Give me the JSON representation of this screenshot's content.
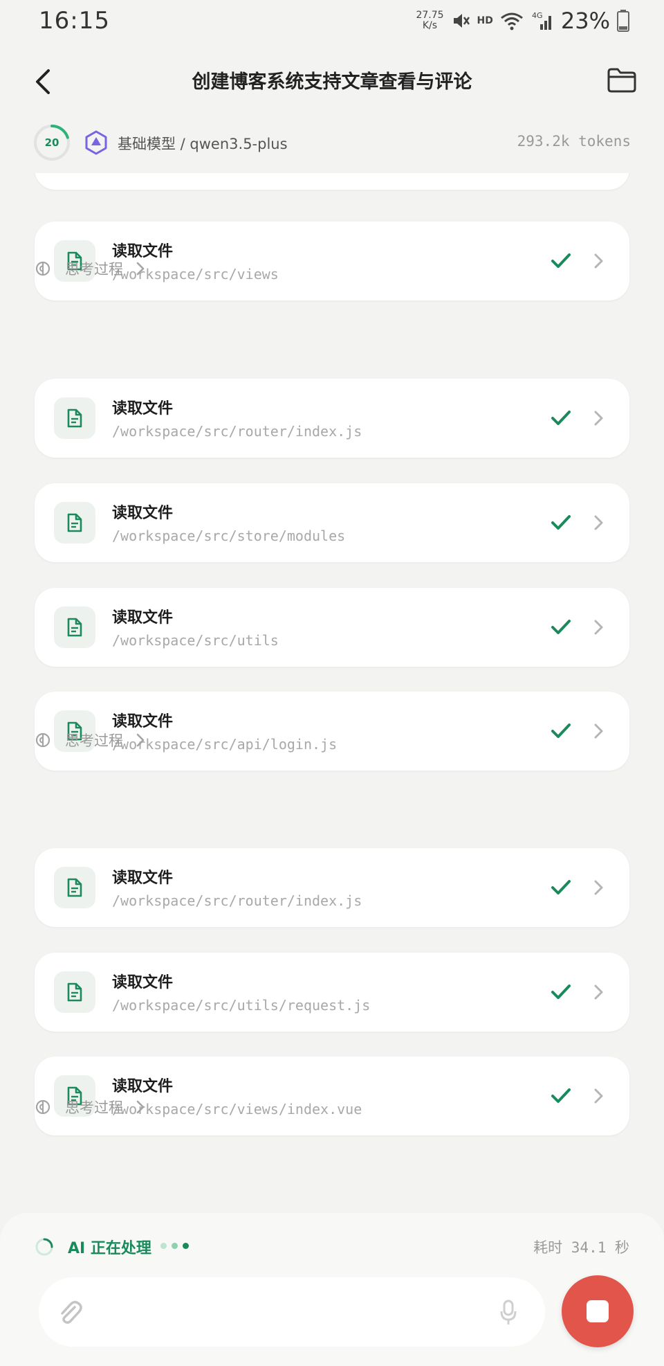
{
  "status_bar": {
    "time": "16:15",
    "speed_value": "27.75",
    "speed_unit": "K/s",
    "hd": "HD",
    "network": "4G",
    "battery": "23%"
  },
  "header": {
    "title": "创建博客系统支持文章查看与评论",
    "back_icon": "back-arrow-icon",
    "folder_icon": "folder-icon"
  },
  "model_bar": {
    "progress": "20",
    "model": "基础模型 / qwen3.5-plus",
    "tokens": "293.2k tokens"
  },
  "items": [
    {
      "type": "file",
      "title": "读取文件",
      "path": "/workspace/src/views",
      "status": "done"
    },
    {
      "type": "think",
      "label": "思考过程"
    },
    {
      "type": "file",
      "title": "读取文件",
      "path": "/workspace/src/router/index.js",
      "status": "done"
    },
    {
      "type": "file",
      "title": "读取文件",
      "path": "/workspace/src/store/modules",
      "status": "done"
    },
    {
      "type": "file",
      "title": "读取文件",
      "path": "/workspace/src/utils",
      "status": "done"
    },
    {
      "type": "file",
      "title": "读取文件",
      "path": "/workspace/src/api/login.js",
      "status": "done"
    },
    {
      "type": "think",
      "label": "思考过程"
    },
    {
      "type": "file",
      "title": "读取文件",
      "path": "/workspace/src/router/index.js",
      "status": "done"
    },
    {
      "type": "file",
      "title": "读取文件",
      "path": "/workspace/src/utils/request.js",
      "status": "done"
    },
    {
      "type": "file",
      "title": "读取文件",
      "path": "/workspace/src/views/index.vue",
      "status": "done"
    },
    {
      "type": "think",
      "label": "思考过程"
    }
  ],
  "bottom": {
    "ai_status": "AI 正在处理",
    "elapsed": "耗时 34.1 秒",
    "input_placeholder": ""
  },
  "colors": {
    "accent": "#1a8a5c",
    "stop": "#e2554b",
    "background": "#f3f3f1"
  }
}
